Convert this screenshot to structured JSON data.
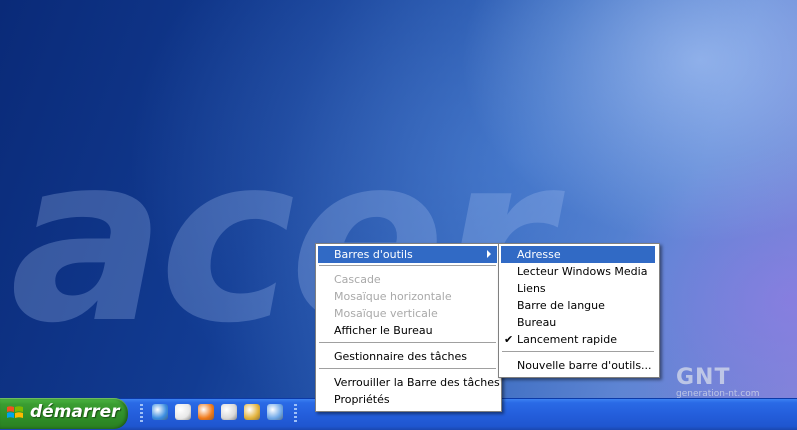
{
  "desktop": {
    "brand_logo": "acer"
  },
  "taskbar": {
    "start_label": "démarrer",
    "quick_launch": [
      {
        "name": "ie-icon",
        "color": "#3b8de0"
      },
      {
        "name": "printer-icon",
        "color": "#e8e8e8"
      },
      {
        "name": "firefox-icon",
        "color": "#f07a1a"
      },
      {
        "name": "archive-icon",
        "color": "#d9d9d9"
      },
      {
        "name": "paint-icon",
        "color": "#e2b23a"
      },
      {
        "name": "document-icon",
        "color": "#6fa8e8"
      }
    ]
  },
  "context_menu": {
    "items": [
      {
        "label": "Barres d'outils",
        "state": "highlighted",
        "submenu": true
      },
      {
        "label": "Cascade",
        "state": "disabled"
      },
      {
        "label": "Mosaïque horizontale",
        "state": "disabled"
      },
      {
        "label": "Mosaïque verticale",
        "state": "disabled"
      },
      {
        "label": "Afficher le Bureau",
        "state": "enabled"
      },
      {
        "label": "Gestionnaire des tâches",
        "state": "enabled"
      },
      {
        "label": "Verrouiller la Barre des tâches",
        "state": "enabled"
      },
      {
        "label": "Propriétés",
        "state": "enabled"
      }
    ]
  },
  "submenu": {
    "items": [
      {
        "label": "Adresse",
        "state": "highlighted"
      },
      {
        "label": "Lecteur Windows Media",
        "state": "enabled"
      },
      {
        "label": "Liens",
        "state": "enabled"
      },
      {
        "label": "Barre de langue",
        "state": "enabled"
      },
      {
        "label": "Bureau",
        "state": "enabled"
      },
      {
        "label": "Lancement rapide",
        "state": "checked"
      },
      {
        "label": "Nouvelle barre d'outils...",
        "state": "enabled"
      }
    ]
  },
  "watermark": {
    "logo": "GNT",
    "site": "generation-nt.com"
  },
  "colors": {
    "highlight": "#316ac5",
    "taskbar": "#245edb",
    "start": "#3a9d31"
  }
}
